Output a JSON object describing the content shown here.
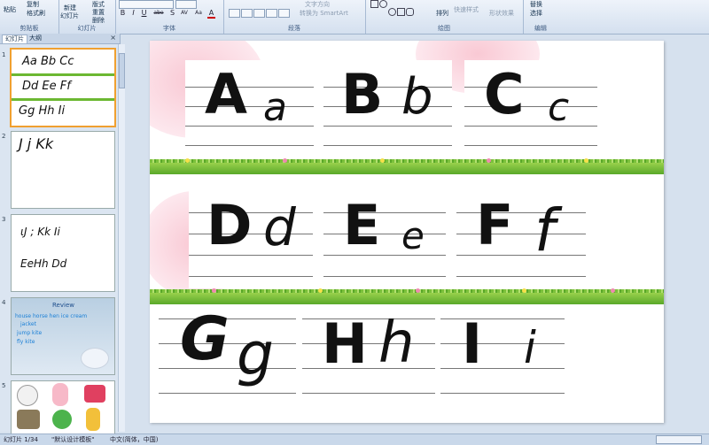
{
  "ribbon": {
    "clipboard": {
      "paste": "粘贴",
      "copy": "复制",
      "format_painter": "格式刷",
      "label": "剪贴板"
    },
    "slides": {
      "new_slide_1": "新建",
      "new_slide_2": "幻灯片",
      "layout": "版式",
      "reset": "重置",
      "delete": "删除",
      "label": "幻灯片"
    },
    "font": {
      "label": "字体",
      "bold": "B",
      "italic": "I",
      "underline": "U",
      "strike": "abe",
      "shadow": "S",
      "spacing": "AV",
      "case": "Aa",
      "color": "A"
    },
    "paragraph": {
      "smartart": "转换为 SmartArt",
      "text_dir": "文字方向",
      "label": "段落"
    },
    "drawing": {
      "arrange": "排列",
      "quick_styles": "快速样式",
      "shape_effects": "形状效果",
      "label": "绘图"
    },
    "editing": {
      "replace": "替换",
      "select": "选择",
      "label": "编辑"
    }
  },
  "pane": {
    "tabs": [
      "幻灯片",
      "大纲"
    ],
    "close": "×",
    "thumbs": [
      {
        "num": "1",
        "rows": [
          "Aa Bb Cc",
          "Dd Ee Ff",
          "Gg Hh Ii"
        ]
      },
      {
        "num": "2",
        "rows": [
          "J j  Kk"
        ]
      },
      {
        "num": "3",
        "rows": [
          "ιJ  ;  Kk  Ii",
          "EeHh  Dd"
        ]
      },
      {
        "num": "4",
        "title": "Review",
        "words": [
          "house  horse  hen  ice cream",
          "jacket",
          "jump  kite",
          "fly kite"
        ]
      },
      {
        "num": "5"
      }
    ]
  },
  "slide": {
    "rows": [
      {
        "letters": [
          {
            "upper": "A",
            "lower": "a"
          },
          {
            "upper": "B",
            "lower": "b"
          },
          {
            "upper": "C",
            "lower": "c"
          }
        ]
      },
      {
        "letters": [
          {
            "upper": "D",
            "lower": "d"
          },
          {
            "upper": "E",
            "lower": "e"
          },
          {
            "upper": "F",
            "lower": "f"
          }
        ]
      },
      {
        "letters": [
          {
            "upper": "G",
            "lower": "g"
          },
          {
            "upper": "H",
            "lower": "h"
          },
          {
            "upper": "I",
            "lower": "i"
          }
        ]
      }
    ]
  },
  "status": {
    "slide_count": "幻灯片 1/34",
    "theme": "\"默认设计模板\"",
    "lang": "中文(简体，中国)"
  },
  "colors": {
    "accent": "#f0a030",
    "ribbon": "#d4e0ef",
    "grass": "#6cb832"
  }
}
